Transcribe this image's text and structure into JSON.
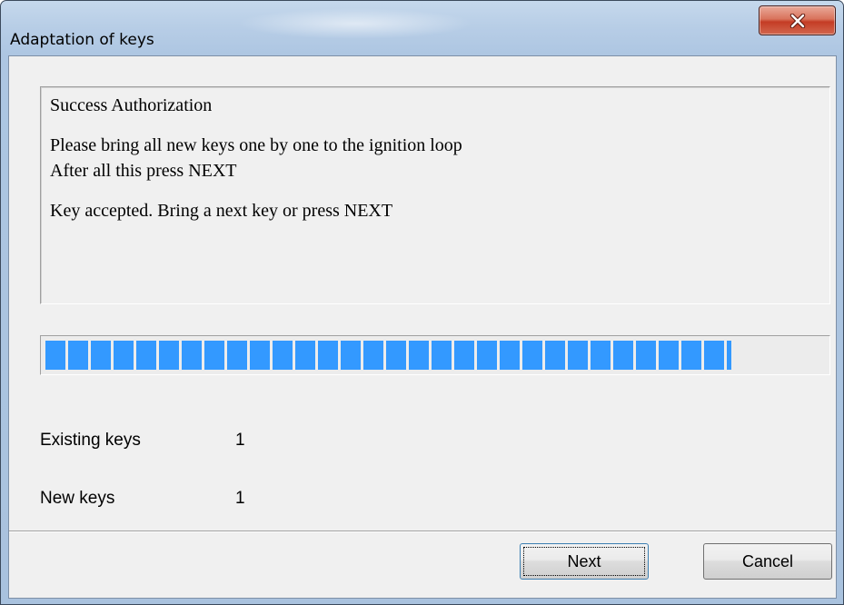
{
  "window": {
    "title": "Adaptation of keys",
    "close_icon": "close-icon"
  },
  "message": {
    "line1": "Success Authorization",
    "line2": "Please bring all new keys one by one to the ignition loop",
    "line3": "After all this press NEXT",
    "line4": "Key accepted. Bring a next key or press NEXT"
  },
  "progress": {
    "percent": 88,
    "color": "#3399ff"
  },
  "info": {
    "existing_label": "Existing keys",
    "existing_value": "1",
    "new_label": "New keys",
    "new_value": "1"
  },
  "buttons": {
    "next": "Next",
    "cancel": "Cancel"
  }
}
